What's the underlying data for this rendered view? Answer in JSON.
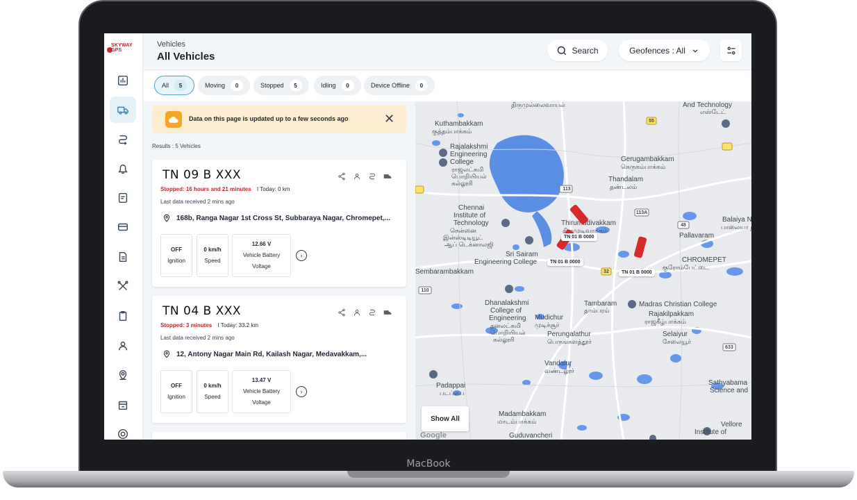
{
  "device": {
    "brand": "MacBook"
  },
  "logo": {
    "text": "SKYWAY GPS"
  },
  "header": {
    "crumb": "Vehicles",
    "title": "All Vehicles",
    "search_label": "Search",
    "geofence_label": "Geofences : All"
  },
  "tabs": [
    {
      "label": "All",
      "count": "5"
    },
    {
      "label": "Moving",
      "count": "0"
    },
    {
      "label": "Stopped",
      "count": "5"
    },
    {
      "label": "Idling",
      "count": "0"
    },
    {
      "label": "Device Offline",
      "count": "0"
    }
  ],
  "notice": {
    "text": "Data on this page is updated up to a few seconds ago"
  },
  "results": "Results : 5 Vehicles",
  "vehicles": [
    {
      "plate": "TN 09 B XXX",
      "stopped": "Stopped: 16 hours and 21 minutes",
      "today": "I Today: 0 km",
      "last": "Last data received 2 mins ago",
      "address": "168b, Ranga Nagar 1st Cross St, Subbaraya Nagar, Chromepet,...",
      "ignition": "OFF",
      "ignition_label": "Ignition",
      "speed": "0 km/h",
      "speed_label": "Speed",
      "battery": "12.66 V",
      "battery_label1": "Vehicle Battery",
      "battery_label2": "Voltage"
    },
    {
      "plate": "TN 04 B XXX",
      "stopped": "Stopped: 3 minutes",
      "today": "I Today: 33.2 km",
      "last": "Last data received 2 mins ago",
      "address": "12, Antony Nagar Main Rd, Kailash Nagar, Medavakkam,...",
      "ignition": "OFF",
      "ignition_label": "Ignition",
      "speed": "0 km/h",
      "speed_label": "Speed",
      "battery": "13.47 V",
      "battery_label1": "Vehicle Battery",
      "battery_label2": "Voltage"
    }
  ],
  "map": {
    "show_all": "Show All",
    "google": "Google",
    "vehicle_tags": [
      "TN 01 B 0000",
      "TN 01 B 0000",
      "TN 01 B 0000"
    ],
    "places": [
      "திருமுல்லைவாயல்",
      "Kuthambakkam",
      "குத்தம்பாக்கம்",
      "Rajalakshmi",
      "Engineering",
      "College",
      "ராஜலட்சுமி",
      "பொறியியல்",
      "கல்லூரி",
      "Chennai",
      "Institute of",
      "Technology",
      "சென்னை",
      "இன்ஸ்டிடியூட்",
      "ஆப் டெக்னாலஜி",
      "Thirumudivakkam",
      "திருமுடிவாக்கம்",
      "Sri Sairam",
      "Engineering College",
      "Sembarambakkam",
      "Dhanalakshmi",
      "College of",
      "Engineering",
      "தனலட்சுமி",
      "பொறியியல்",
      "கல்லூரி",
      "Mudichur",
      "முடிச்சூர்",
      "Perungalathur",
      "பெருங்களத்தூர்",
      "Padappai",
      "படப்பை",
      "Vandalur",
      "வண்டலூர்",
      "Madambakkam",
      "மாடம்பாக்கம்",
      "Guduvancheri",
      "Gerugambakkam",
      "கெருகம்பாக்கம்",
      "Thandalam",
      "தண்டலம்",
      "Pallavaram",
      "CHROMEPET",
      "குரோம்பேட்டை",
      "Tambaram",
      "தாம்பரம்",
      "Madras Christian College",
      "Rajakilpakkam",
      "ராஜகீழ்பாக்கம்",
      "Selaiyur",
      "சேலையூர்",
      "Sathyabama",
      "Science and",
      "Vellore",
      "Institute of",
      "And Technology",
      "எஸ்டேட்",
      "Balaiya Na",
      "பாலையா ந",
      "113",
      "113A",
      "48",
      "32",
      "55",
      "110",
      "633"
    ]
  }
}
